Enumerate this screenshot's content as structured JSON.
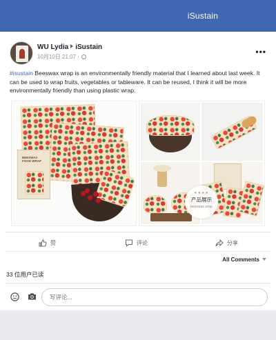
{
  "header": {
    "title": "iSustain"
  },
  "post": {
    "author": "WU Lydia",
    "group": "iSustain",
    "timestamp": "10月10日 21:07 ·",
    "more_label": "•••",
    "hashtag": "#isustain",
    "body": " Beeswax wrap is an environmentally friendly material that I learned about last week. It can be used to wrap fruits, vegetables or tableware. It can be reused, I think it will be more environmentally friendly than using plastic wrap.",
    "package_label": "BEESWAX FOOD WRAP",
    "badge_title": "产品展示",
    "badge_subtitle": "beeswax wrap",
    "badge_stars": "★★★★"
  },
  "actions": {
    "like": "赞",
    "comment": "评论",
    "share": "分享"
  },
  "comments": {
    "filter_label": "All Comments",
    "seen_text": "33 位用户已读",
    "placeholder": "写评论..."
  },
  "colors": {
    "brand": "#4267b2",
    "link": "#4267b2",
    "background": "#e9ebee"
  }
}
